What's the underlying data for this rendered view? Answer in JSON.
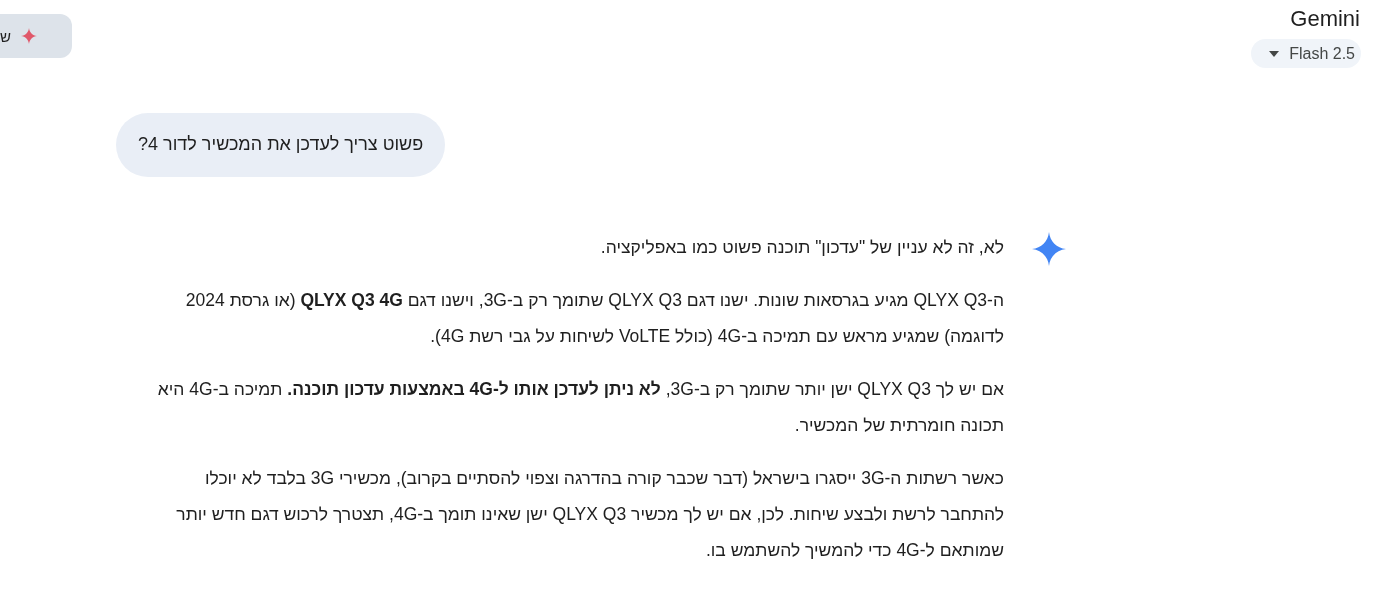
{
  "top_bar": {
    "upgrade_button": {
      "label": "ש"
    },
    "title": "Gemini",
    "model_selector": {
      "label": "Flash 2.5"
    }
  },
  "conversation": {
    "user_message": "פשוט צריך לעדכן את המכשיר לדור 4?",
    "response": {
      "paragraphs": [
        "לא, זה לא עניין של \"עדכון\" תוכנה פשוט כמו באפליקציה.",
        "ה-QLYX Q3 מגיע בגרסאות שונות. ישנו דגם QLYX Q3 שתומך רק ב-3G, וישנו דגם **QLYX Q3 4G** (או גרסת 2024 לדוגמה) שמגיע מראש עם תמיכה ב-4G (כולל VoLTE לשיחות על גבי רשת 4G).",
        "אם יש לך QLYX Q3 ישן יותר שתומך רק ב-3G, **לא ניתן לעדכן אותו ל-4G באמצעות עדכון תוכנה.** תמיכה ב-4G היא תכונה חומרתית של המכשיר.",
        "כאשר רשתות ה-3G ייסגרו בישראל (דבר שכבר קורה בהדרגה וצפוי להסתיים בקרוב), מכשירי 3G בלבד לא יוכלו להתחבר לרשת ולבצע שיחות. לכן, אם יש לך מכשיר QLYX Q3 ישן שאינו תומך ב-4G, תצטרך לרכוש דגם חדש יותר שמותאם ל-4G כדי להמשיך להשתמש בו."
      ]
    }
  }
}
